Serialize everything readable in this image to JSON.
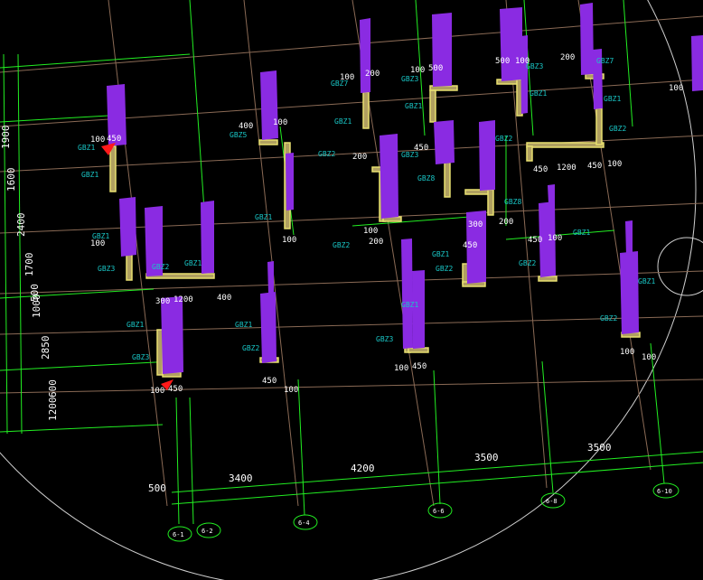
{
  "colors": {
    "background": "#000000",
    "grid_line": "#8a6a55",
    "dim_line": "#22ee22",
    "column": "#8a2be2",
    "column_dark": "#5a1aa0",
    "wall_outline": "#e8e070",
    "wall_fill": "#b0a060",
    "label": "#19c6c6",
    "text": "#ffffff",
    "boundary": "#cfcfcf",
    "marker": "#ff1a1a"
  },
  "axis_bubbles": [
    "6-1",
    "6-2",
    "6-4",
    "6-6",
    "6-8",
    "6-10"
  ],
  "bottom_dimensions": [
    "500",
    "3400",
    "4200",
    "3500",
    "3500"
  ],
  "left_dimensions": [
    "1900",
    "1600",
    "2400",
    "1700",
    "1000",
    "500",
    "2850",
    "600",
    "1200"
  ],
  "wall_tags": [
    "GBZ1",
    "GBZ2",
    "GBZ3",
    "GBZ5",
    "GBZ7",
    "GBZ8"
  ],
  "small_dims": [
    "100",
    "200",
    "300",
    "400",
    "450",
    "500",
    "550",
    "1200"
  ]
}
